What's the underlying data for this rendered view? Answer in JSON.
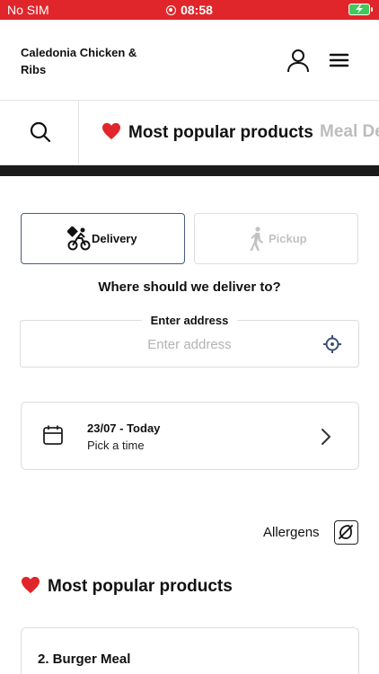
{
  "status_bar": {
    "carrier": "No SIM",
    "time": "08:58"
  },
  "header": {
    "brand": "Caledonia Chicken & Ribs",
    "account_icon": "user-icon",
    "menu_icon": "hamburger-menu-icon"
  },
  "categories": {
    "search_icon": "search-icon",
    "tabs": [
      {
        "label": "Most popular products",
        "icon": "heart-emoji",
        "active": true
      },
      {
        "label": "Meal De",
        "active": false
      }
    ]
  },
  "order_mode": {
    "options": [
      {
        "label": "Delivery",
        "icon": "bike-courier-icon",
        "selected": true
      },
      {
        "label": "Pickup",
        "icon": "walking-person-icon",
        "selected": false
      }
    ]
  },
  "address": {
    "question": "Where should we deliver to?",
    "legend": "Enter address",
    "placeholder": "Enter address",
    "value": "",
    "locate_icon": "crosshair-icon"
  },
  "time_picker": {
    "date": "23/07 - Today",
    "hint": "Pick a time",
    "icon": "calendar-icon"
  },
  "allergens": {
    "label": "Allergens",
    "icon": "allergen-icon"
  },
  "section": {
    "title": "Most popular products"
  },
  "products": [
    {
      "name": "2. Burger Meal"
    }
  ],
  "colors": {
    "status_bar": "#e0262b",
    "selected_border": "#4a5b7c",
    "heart": "#e0262b"
  }
}
